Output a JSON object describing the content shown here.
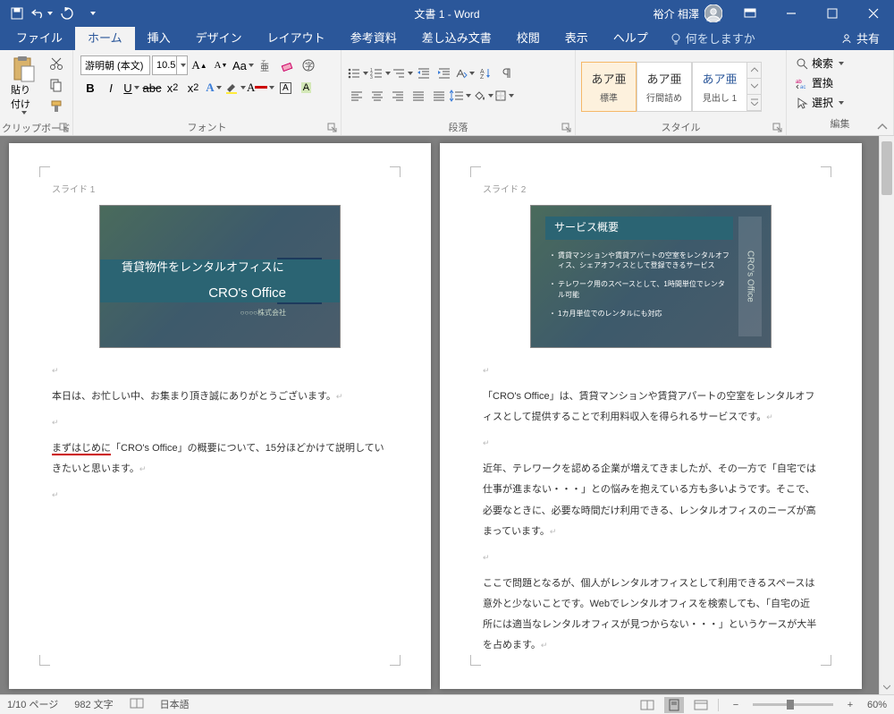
{
  "titlebar": {
    "title": "文書 1 - Word",
    "user": "裕介 相澤"
  },
  "tabs": {
    "items": [
      "ファイル",
      "ホーム",
      "挿入",
      "デザイン",
      "レイアウト",
      "参考資料",
      "差し込み文書",
      "校閲",
      "表示",
      "ヘルプ"
    ],
    "active": 1,
    "tell": "何をしますか",
    "share": "共有"
  },
  "ribbon": {
    "clipboard": {
      "paste": "貼り付け",
      "label": "クリップボード"
    },
    "font": {
      "name": "游明朝 (本文)",
      "size": "10.5",
      "label": "フォント"
    },
    "paragraph": {
      "label": "段落"
    },
    "styles": {
      "label": "スタイル",
      "items": [
        {
          "preview": "あア亜",
          "name": "標準",
          "selected": true
        },
        {
          "preview": "あア亜",
          "name": "行間詰め",
          "selected": false
        },
        {
          "preview": "あア亜",
          "name": "見出し 1",
          "selected": false
        }
      ]
    },
    "editing": {
      "find": "検索",
      "replace": "置換",
      "select": "選択",
      "label": "編集"
    }
  },
  "doc": {
    "page1": {
      "slideLabel": "スライド 1",
      "slide": {
        "line1": "賃貸物件をレンタルオフィスに",
        "line2": "CRO's Office",
        "sub": "○○○○株式会社"
      },
      "p1": "本日は、お忙しい中、お集まり頂き誠にありがとうございます。",
      "p2a": "まずはじめに",
      "p2b": "「CRO's Office」の概要について、15分ほどかけて説明していきたいと思います。"
    },
    "page2": {
      "slideLabel": "スライド 2",
      "slide": {
        "title": "サービス概要",
        "side": "CRO's Office",
        "b1": "賃貸マンションや賃貸アパートの空室をレンタルオフィス、シェアオフィスとして登録できるサービス",
        "b2": "テレワーク用のスペースとして、1時間単位でレンタル可能",
        "b3": "1カ月単位でのレンタルにも対応"
      },
      "p1": "「CRO's Office」は、賃貸マンションや賃貸アパートの空室をレンタルオフィスとして提供することで利用料収入を得られるサービスです。",
      "p2": "近年、テレワークを認める企業が増えてきましたが、その一方で「自宅では仕事が進まない・・・」との悩みを抱えている方も多いようです。そこで、必要なときに、必要な時間だけ利用できる、レンタルオフィスのニーズが高まっています。",
      "p3": "ここで問題となるが、個人がレンタルオフィスとして利用できるスペースは意外と少ないことです。Webでレンタルオフィスを検索しても、「自宅の近所には適当なレンタルオフィスが見つからない・・・」というケースが大半を占めます。"
    }
  },
  "status": {
    "page": "1/10 ページ",
    "words": "982 文字",
    "lang": "日本語",
    "zoom": "60%"
  }
}
